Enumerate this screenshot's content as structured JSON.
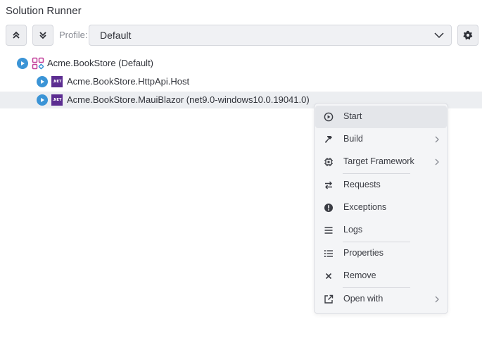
{
  "panel": {
    "title": "Solution Runner"
  },
  "toolbar": {
    "collapse_all_icon": "chevrons-up-icon",
    "expand_all_icon": "chevrons-down-icon",
    "profile_label": "Profile:",
    "profile_value": "Default",
    "settings_icon": "gear-icon"
  },
  "tree": {
    "solution": {
      "label": "Acme.BookStore (Default)"
    },
    "projects": [
      {
        "label": "Acme.BookStore.HttpApi.Host",
        "badge": ".NET"
      },
      {
        "label": "Acme.BookStore.MauiBlazor (net9.0-windows10.0.19041.0)",
        "badge": ".NET"
      }
    ]
  },
  "context_menu": {
    "items": [
      {
        "label": "Start",
        "icon": "play-circle-icon"
      },
      {
        "label": "Build",
        "icon": "hammer-icon",
        "submenu": true
      },
      {
        "label": "Target Framework",
        "icon": "chip-icon",
        "submenu": true
      },
      {
        "label": "Requests",
        "icon": "swap-arrows-icon"
      },
      {
        "label": "Exceptions",
        "icon": "exclamation-circle-icon"
      },
      {
        "label": "Logs",
        "icon": "lines-icon"
      },
      {
        "label": "Properties",
        "icon": "list-icon"
      },
      {
        "label": "Remove",
        "icon": "close-icon"
      },
      {
        "label": "Open with",
        "icon": "external-link-icon",
        "submenu": true
      }
    ]
  },
  "colors": {
    "accent": "#3b94d6",
    "dotnet": "#5c2d91",
    "solution_icon": "#c2409a"
  }
}
